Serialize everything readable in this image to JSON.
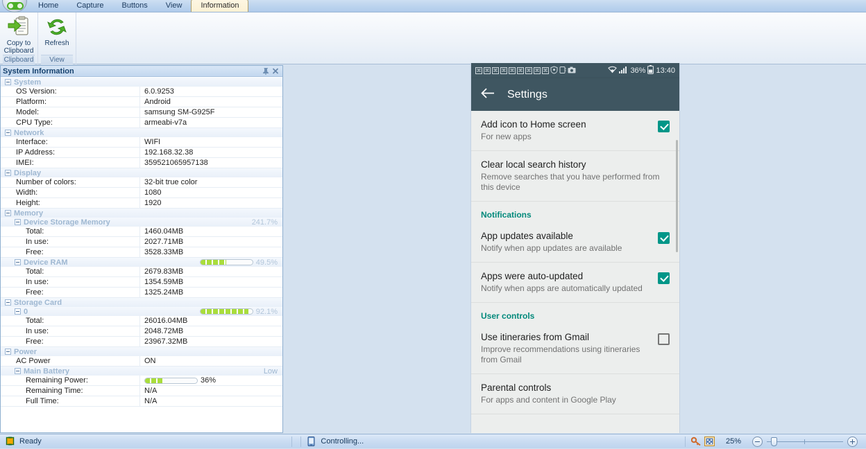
{
  "app": {
    "logo_icon": "green-app-logo-icon"
  },
  "ribbon": {
    "tabs": [
      {
        "label": "Home",
        "active": false
      },
      {
        "label": "Capture",
        "active": false
      },
      {
        "label": "Buttons",
        "active": false
      },
      {
        "label": "View",
        "active": false
      },
      {
        "label": "Information",
        "active": true
      }
    ],
    "groups": [
      {
        "label": "Clipboard",
        "buttons": [
          {
            "label": "Copy to\nClipboard",
            "line1": "Copy to",
            "line2": "Clipboard",
            "icon": "clipboard-copy-icon"
          }
        ]
      },
      {
        "label": "View",
        "buttons": [
          {
            "label": "Refresh",
            "line1": "Refresh",
            "line2": "",
            "icon": "refresh-icon"
          }
        ]
      }
    ]
  },
  "sysinfo": {
    "title": "System Information",
    "pin_icon": "pin-icon",
    "close_icon": "close-icon",
    "sections": [
      {
        "name": "System",
        "level": 0,
        "badge": "",
        "meter": null,
        "rows": [
          {
            "key": "OS Version:",
            "value": "6.0.9253"
          },
          {
            "key": "Platform:",
            "value": "Android"
          },
          {
            "key": "Model:",
            "value": "samsung SM-G925F"
          },
          {
            "key": "CPU Type:",
            "value": "armeabi-v7a"
          }
        ]
      },
      {
        "name": "Network",
        "level": 0,
        "badge": "",
        "meter": null,
        "rows": [
          {
            "key": "Interface:",
            "value": "WIFI"
          },
          {
            "key": "IP Address:",
            "value": "192.168.32.38"
          },
          {
            "key": "IMEI:",
            "value": "359521065957138"
          }
        ]
      },
      {
        "name": "Display",
        "level": 0,
        "badge": "",
        "meter": null,
        "rows": [
          {
            "key": "Number of colors:",
            "value": "32-bit true color"
          },
          {
            "key": "Width:",
            "value": "1080"
          },
          {
            "key": "Height:",
            "value": "1920"
          }
        ]
      },
      {
        "name": "Memory",
        "level": 0,
        "badge": "",
        "meter": null,
        "rows": []
      },
      {
        "name": "Device Storage Memory",
        "level": 1,
        "badge": "241.7%",
        "meter": null,
        "rows": [
          {
            "key": "Total:",
            "value": "1460.04MB"
          },
          {
            "key": "In use:",
            "value": "2027.71MB"
          },
          {
            "key": "Free:",
            "value": "3528.33MB"
          }
        ]
      },
      {
        "name": "Device RAM",
        "level": 1,
        "badge": "49.5%",
        "meter": 49.5,
        "rows": [
          {
            "key": "Total:",
            "value": "2679.83MB"
          },
          {
            "key": "In use:",
            "value": "1354.59MB"
          },
          {
            "key": "Free:",
            "value": "1325.24MB"
          }
        ]
      },
      {
        "name": "Storage Card",
        "level": 0,
        "badge": "",
        "meter": null,
        "rows": []
      },
      {
        "name": "0",
        "level": 1,
        "badge": "92.1%",
        "meter": 92.1,
        "rows": [
          {
            "key": "Total:",
            "value": "26016.04MB"
          },
          {
            "key": "In use:",
            "value": "2048.72MB"
          },
          {
            "key": "Free:",
            "value": "23967.32MB"
          }
        ]
      },
      {
        "name": "Power",
        "level": 0,
        "badge": "",
        "meter": null,
        "rows": [
          {
            "key": "AC Power",
            "value": "ON"
          }
        ]
      },
      {
        "name": "Main Battery",
        "level": 1,
        "badge": "Low",
        "meter": null,
        "rows": [
          {
            "key": "Remaining Power:",
            "value": "36%",
            "meter": 36
          },
          {
            "key": "Remaining Time:",
            "value": "N/A"
          },
          {
            "key": "Full Time:",
            "value": "N/A"
          }
        ]
      }
    ]
  },
  "phone": {
    "statusbar": {
      "placeholder_icons": [
        "box-glyph-icon",
        "box-glyph-icon",
        "box-glyph-icon",
        "box-glyph-icon",
        "box-glyph-icon",
        "box-glyph-icon",
        "box-glyph-icon",
        "box-glyph-icon",
        "box-glyph-icon"
      ],
      "shield_icon": "shield-icon",
      "sim_icon": "sim-card-icon",
      "camera_icon": "camera-icon",
      "wifi_icon": "wifi-icon",
      "signal_icon": "signal-bars-icon",
      "battery_text": "36%",
      "battery_icon": "battery-icon",
      "clock": "13:40"
    },
    "appbar": {
      "back_icon": "back-arrow-icon",
      "title": "Settings"
    },
    "items": [
      {
        "kind": "item",
        "title": "Add icon to Home screen",
        "subtitle": "For new apps",
        "checkbox": "checked"
      },
      {
        "kind": "item",
        "title": "Clear local search history",
        "subtitle": "Remove searches that you have performed from this device",
        "checkbox": "none"
      },
      {
        "kind": "header",
        "title": "Notifications",
        "subtitle": "",
        "checkbox": "none"
      },
      {
        "kind": "item",
        "title": "App updates available",
        "subtitle": "Notify when app updates are available",
        "checkbox": "checked"
      },
      {
        "kind": "item",
        "title": "Apps were auto-updated",
        "subtitle": "Notify when apps are automatically updated",
        "checkbox": "checked"
      },
      {
        "kind": "header",
        "title": "User controls",
        "subtitle": "",
        "checkbox": "none"
      },
      {
        "kind": "item",
        "title": "Use itineraries from Gmail",
        "subtitle": "Improve recommendations using itineraries from Gmail",
        "checkbox": "unchecked"
      },
      {
        "kind": "item",
        "title": "Parental controls",
        "subtitle": "For apps and content in Google Play",
        "checkbox": "none"
      }
    ]
  },
  "statusbar": {
    "ready_icon": "ready-icon",
    "ready_text": "Ready",
    "device_icon": "device-icon",
    "device_text": "Controlling...",
    "key_icon": "key-icon",
    "layout_icon": "layout-icon",
    "zoom_level": "25%",
    "zoom_out_icon": "zoom-out-icon",
    "zoom_in_icon": "zoom-in-icon"
  },
  "colors": {
    "accent_teal": "#009688",
    "ribbon_blue": "#bdd4ee",
    "workspace": "#d4e1ef",
    "meter_green": "#a9dd3c"
  }
}
